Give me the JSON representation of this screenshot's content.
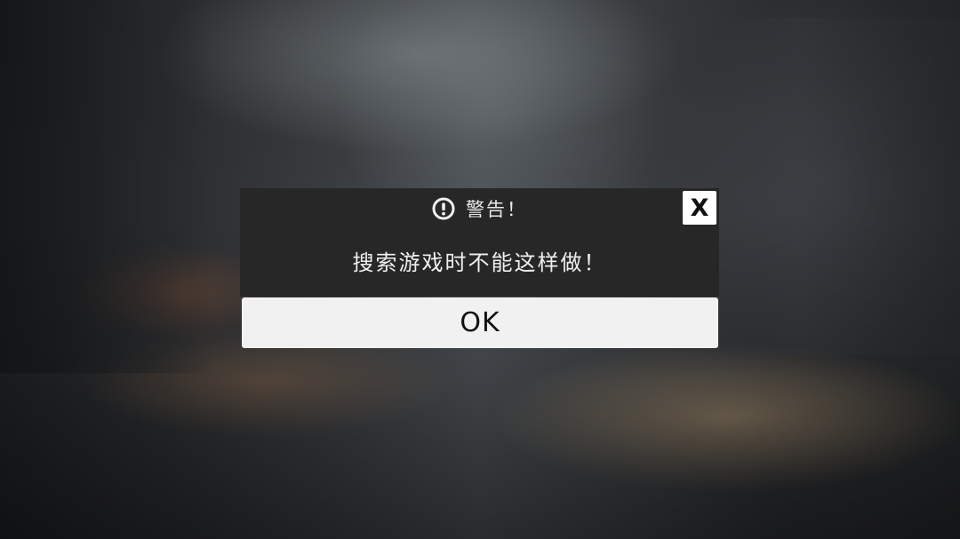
{
  "dialog": {
    "title": "警告！",
    "icon": "exclamation-circle-icon",
    "message": "搜索游戏时不能这样做！",
    "close_label": "X",
    "ok_label": "OK"
  },
  "colors": {
    "dialog_background": "#272727",
    "dialog_text": "#f0f0f0",
    "button_background": "#f1f1f1",
    "button_text": "#111111",
    "close_background": "#ffffff"
  }
}
